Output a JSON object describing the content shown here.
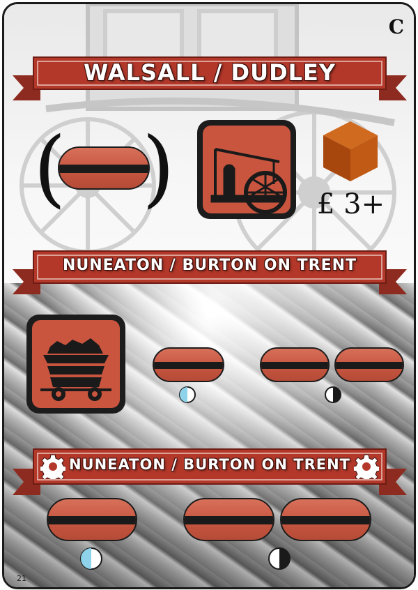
{
  "card": {
    "letter": "C",
    "page_number": "21"
  },
  "top": {
    "banner_title": "WALSALL / DUDLEY",
    "price": "£ 3+",
    "industry_icon": "engine-icon",
    "resource_icon": "cube-icon",
    "resource_color": "#b5520f"
  },
  "middle": {
    "banner_title": "NUNEATON / BURTON ON TRENT",
    "industry_icon": "coal-cart-icon",
    "links": [
      {
        "era_marker": "light-blue-half"
      },
      {
        "era_marker": "black-half"
      }
    ]
  },
  "bottom": {
    "banner_title": "NUNEATON / BURTON ON TRENT",
    "banner_icon": "gear-icon",
    "links": [
      {
        "era_marker": "light-blue-half"
      },
      {
        "era_marker": "black-half"
      }
    ]
  },
  "colors": {
    "link_red": "#c65640",
    "banner_red": "#b3382a",
    "light_blue": "#8ed3ea",
    "dark": "#1a1a1a"
  }
}
